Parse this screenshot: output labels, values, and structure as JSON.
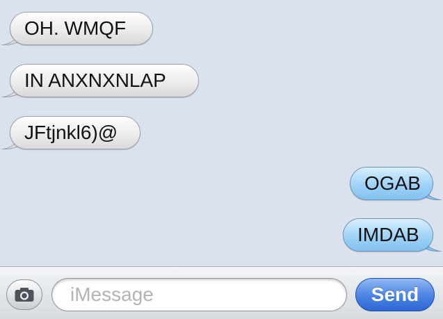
{
  "thread": {
    "messages": [
      {
        "sender": "received",
        "text": "OH. WMQF"
      },
      {
        "sender": "received",
        "text": "IN ANXNXNLAP"
      },
      {
        "sender": "received",
        "text": "JFtjnkl6)@"
      },
      {
        "sender": "sent",
        "text": "OGAB"
      },
      {
        "sender": "sent",
        "text": "IMDAB"
      }
    ]
  },
  "composer": {
    "camera_icon": "camera-icon",
    "input_placeholder": "iMessage",
    "send_label": "Send"
  },
  "colors": {
    "background": "#dbe2ed",
    "received_bubble": "#e9e9e9",
    "sent_bubble": "#9fd2f7",
    "send_button": "#4f88e6"
  }
}
